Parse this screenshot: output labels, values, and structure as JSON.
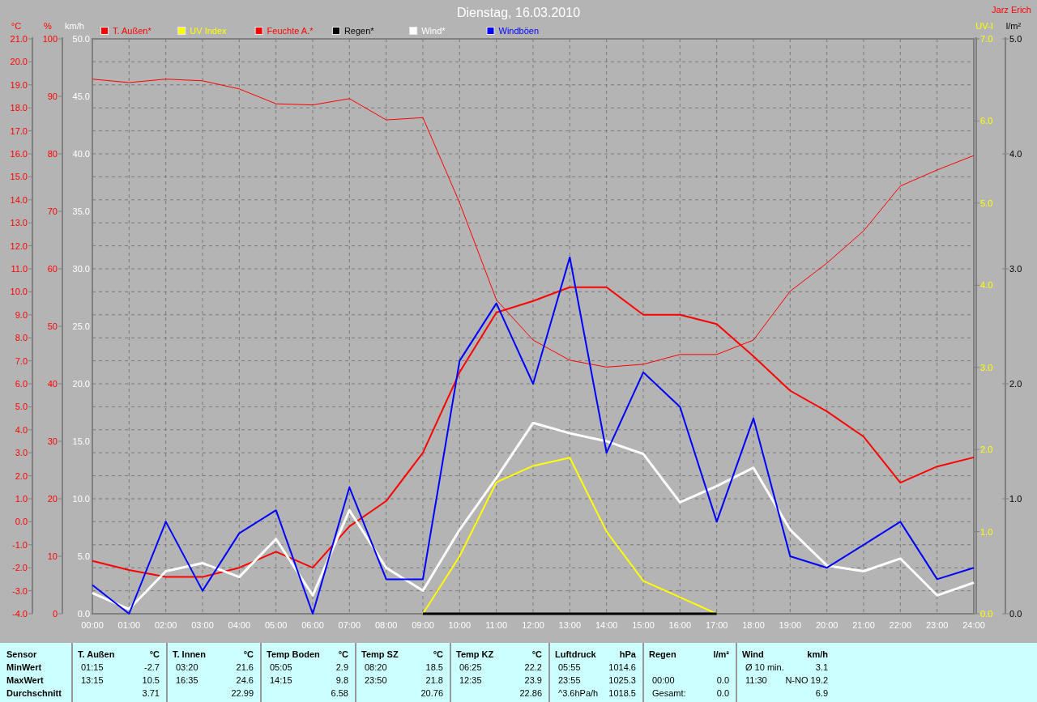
{
  "title": "Dienstag, 16.03.2010",
  "author": "Jarz Erich",
  "chart": {
    "chart_data": {
      "type": "line",
      "legend": "top",
      "grid": true,
      "x": [
        "00:00",
        "01:00",
        "02:00",
        "03:00",
        "04:00",
        "05:00",
        "06:00",
        "07:00",
        "08:00",
        "09:00",
        "10:00",
        "11:00",
        "12:00",
        "13:00",
        "14:00",
        "15:00",
        "16:00",
        "17:00",
        "18:00",
        "19:00",
        "20:00",
        "21:00",
        "22:00",
        "23:00",
        "24:00"
      ],
      "ylabel": "km/h",
      "ylim": [
        0,
        50
      ],
      "yticks": [
        {
          "value": 50,
          "label": "50.0"
        },
        {
          "value": 45,
          "label": "45.0"
        },
        {
          "value": 40,
          "label": "40.0"
        },
        {
          "value": 35,
          "label": "35.0"
        },
        {
          "value": 30,
          "label": "30.0"
        },
        {
          "value": 25,
          "label": "25.0"
        },
        {
          "value": 20,
          "label": "20.0"
        },
        {
          "value": 15,
          "label": "15.0"
        },
        {
          "value": 10,
          "label": "10.0"
        },
        {
          "value": 5,
          "label": "5.0"
        },
        {
          "value": 0,
          "label": "0.0"
        }
      ],
      "y2label": "°C",
      "y2lim": [
        -4,
        21
      ],
      "y2ticks": [
        {
          "value": 21,
          "label": "21.0"
        },
        {
          "value": 20,
          "label": "20.0"
        },
        {
          "value": 19,
          "label": "19.0"
        },
        {
          "value": 18,
          "label": "18.0"
        },
        {
          "value": 17,
          "label": "17.0"
        },
        {
          "value": 16,
          "label": "16.0"
        },
        {
          "value": 15,
          "label": "15.0"
        },
        {
          "value": 14,
          "label": "14.0"
        },
        {
          "value": 13,
          "label": "13.0"
        },
        {
          "value": 12,
          "label": "12.0"
        },
        {
          "value": 11,
          "label": "11.0"
        },
        {
          "value": 10,
          "label": "10.0"
        },
        {
          "value": 9,
          "label": "9.0"
        },
        {
          "value": 8,
          "label": "8.0"
        },
        {
          "value": 7,
          "label": "7.0"
        },
        {
          "value": 6,
          "label": "6.0"
        },
        {
          "value": 5,
          "label": "5.0"
        },
        {
          "value": 4,
          "label": "4.0"
        },
        {
          "value": 3,
          "label": "3.0"
        },
        {
          "value": 2,
          "label": "2.0"
        },
        {
          "value": 1,
          "label": "1.0"
        },
        {
          "value": 0,
          "label": "0.0"
        },
        {
          "value": -1,
          "label": "-1.0"
        },
        {
          "value": -2,
          "label": "-2.0"
        },
        {
          "value": -3,
          "label": "-3.0"
        },
        {
          "value": -4,
          "label": "-4.0"
        }
      ],
      "y3label": "%",
      "y3lim": [
        0,
        100
      ],
      "y3ticks": [
        {
          "value": 100,
          "label": "100"
        },
        {
          "value": 90,
          "label": "90"
        },
        {
          "value": 80,
          "label": "80"
        },
        {
          "value": 70,
          "label": "70"
        },
        {
          "value": 60,
          "label": "60"
        },
        {
          "value": 50,
          "label": "50"
        },
        {
          "value": 40,
          "label": "40"
        },
        {
          "value": 30,
          "label": "30"
        },
        {
          "value": 20,
          "label": "20"
        },
        {
          "value": 10,
          "label": "10"
        },
        {
          "value": 0,
          "label": "0"
        }
      ],
      "series": [
        {
          "name": "T. Außen*",
          "color": "#ff0000",
          "axis": "y2",
          "values": [
            -1.7,
            -2.1,
            -2.4,
            -2.4,
            -2.0,
            -1.3,
            -2.0,
            -0.2,
            0.9,
            3.0,
            6.5,
            9.1,
            9.6,
            10.2,
            10.2,
            9.0,
            9.0,
            8.6,
            7.2,
            5.7,
            4.8,
            3.7,
            1.7,
            2.4,
            2.8
          ]
        },
        {
          "name": "Feuchte A.*",
          "color": "#ff0000",
          "axis": "y3",
          "values": [
            93.0,
            92.4,
            93.0,
            92.7,
            91.3,
            88.7,
            88.5,
            89.6,
            85.9,
            86.3,
            71.5,
            54.6,
            47.6,
            44.1,
            42.9,
            43.4,
            45.1,
            45.1,
            47.6,
            56.1,
            61.0,
            66.6,
            74.4,
            77.2,
            79.7
          ]
        },
        {
          "name": "Wind*",
          "color": "#ffffff",
          "values": [
            1.8,
            0.4,
            3.7,
            4.4,
            3.2,
            6.5,
            1.6,
            9.0,
            4.0,
            2.0,
            7.3,
            11.8,
            16.6,
            15.7,
            15.0,
            13.9,
            9.7,
            11.1,
            12.7,
            7.3,
            4.2,
            3.7,
            4.8,
            1.6,
            2.7
          ]
        },
        {
          "name": "Windböen",
          "color": "#0000ff",
          "values": [
            2.5,
            0.0,
            8.0,
            2.0,
            7.0,
            9.0,
            0.0,
            11.0,
            3.0,
            3.0,
            22.0,
            27.0,
            20.0,
            31.0,
            14.0,
            21.0,
            18.0,
            8.0,
            17.0,
            5.0,
            4.0,
            6.0,
            8.0,
            3.0,
            4.0
          ]
        }
      ]
    },
    "uv": {
      "chart_data": {
        "type": "line",
        "ylabel": "UV-I",
        "ylim": [
          0,
          7
        ],
        "yticks": [
          {
            "value": 7,
            "label": "7.0"
          },
          {
            "value": 6,
            "label": "6.0"
          },
          {
            "value": 5,
            "label": "5.0"
          },
          {
            "value": 4,
            "label": "4.0"
          },
          {
            "value": 3,
            "label": "3.0"
          },
          {
            "value": 2,
            "label": "2.0"
          },
          {
            "value": 1,
            "label": "1.0"
          },
          {
            "value": 0,
            "label": "0.0"
          }
        ],
        "series": [
          {
            "name": "UV Index",
            "color": "#ffff00",
            "values": [
              null,
              null,
              null,
              null,
              null,
              null,
              null,
              null,
              null,
              0.0,
              0.7,
              1.6,
              1.8,
              1.9,
              1.0,
              0.4,
              0.2,
              0.0,
              null,
              null,
              null,
              null,
              null,
              null,
              null
            ]
          }
        ]
      }
    },
    "rain": {
      "chart_data": {
        "type": "line",
        "ylabel": "l/m²",
        "ylim": [
          0,
          5
        ],
        "yticks": [
          {
            "value": 5,
            "label": "5.0"
          },
          {
            "value": 4,
            "label": "4.0"
          },
          {
            "value": 3,
            "label": "3.0"
          },
          {
            "value": 2,
            "label": "2.0"
          },
          {
            "value": 1,
            "label": "1.0"
          },
          {
            "value": 0,
            "label": "0.0"
          }
        ],
        "series": [
          {
            "name": "Regen*",
            "color": "#000000",
            "values": [
              null,
              null,
              null,
              null,
              null,
              null,
              null,
              null,
              null,
              0.0,
              0.0,
              0.0,
              0.0,
              0.0,
              0.0,
              0.0,
              0.0,
              0.0,
              null,
              null,
              null,
              null,
              null,
              null,
              null
            ]
          }
        ]
      }
    }
  },
  "stats": {
    "row_labels": [
      "Sensor",
      "MinWert",
      "MaxWert",
      "Durchschnitt"
    ],
    "sections": [
      {
        "name": "T. Außen",
        "unit": "°C",
        "rows": [
          [
            "01:15",
            "-2.7"
          ],
          [
            "13:15",
            "10.5"
          ],
          [
            null,
            "3.71"
          ]
        ]
      },
      {
        "name": "T. Innen",
        "unit": "°C",
        "rows": [
          [
            "03:20",
            "21.6"
          ],
          [
            "16:35",
            "24.6"
          ],
          [
            null,
            "22.99"
          ]
        ]
      },
      {
        "name": "Temp Boden",
        "unit": "°C",
        "rows": [
          [
            "05:05",
            "2.9"
          ],
          [
            "14:15",
            "9.8"
          ],
          [
            null,
            "6.58"
          ]
        ]
      },
      {
        "name": "Temp SZ",
        "unit": "°C",
        "rows": [
          [
            "08:20",
            "18.5"
          ],
          [
            "23:50",
            "21.8"
          ],
          [
            null,
            "20.76"
          ]
        ]
      },
      {
        "name": "Temp KZ",
        "unit": "°C",
        "rows": [
          [
            "06:25",
            "22.2"
          ],
          [
            "12:35",
            "23.9"
          ],
          [
            null,
            "22.86"
          ]
        ]
      },
      {
        "name": "Luftdruck",
        "unit": "hPa",
        "rows": [
          [
            "05:55",
            "1014.6"
          ],
          [
            "23:55",
            "1025.3"
          ],
          [
            "^3.6hPa/h",
            "1018.5"
          ]
        ]
      },
      {
        "name": "Regen",
        "unit": "l/m²",
        "rows": [
          [
            null,
            null
          ],
          [
            "00:00",
            "0.0"
          ],
          [
            "Gesamt:",
            "0.0"
          ]
        ]
      },
      {
        "name": "Wind",
        "unit": "km/h",
        "rows": [
          [
            "Ø 10 min.",
            "3.1"
          ],
          [
            "11:30",
            "N-NO 19.2"
          ],
          [
            null,
            "6.9"
          ]
        ]
      }
    ]
  }
}
